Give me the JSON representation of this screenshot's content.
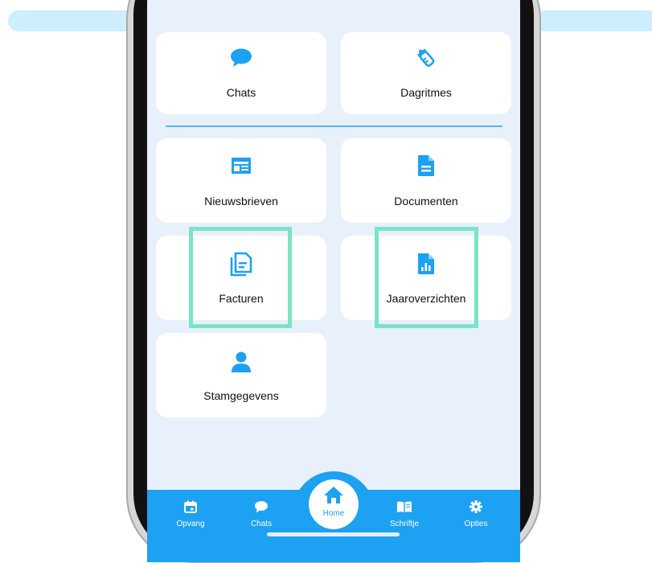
{
  "colors": {
    "accent": "#1da1f2",
    "highlight": "#7be4c6",
    "screen_bg": "#e8f1fb"
  },
  "grid": {
    "chats": {
      "label": "Chats",
      "icon": "chat-bubble-icon"
    },
    "dagritmes": {
      "label": "Dagritmes",
      "icon": "baby-bottle-icon"
    },
    "nieuwsbrieven": {
      "label": "Nieuwsbrieven",
      "icon": "newspaper-icon"
    },
    "documenten": {
      "label": "Documenten",
      "icon": "document-icon"
    },
    "facturen": {
      "label": "Facturen",
      "icon": "invoice-copy-icon"
    },
    "jaaroverzichten": {
      "label": "Jaaroverzichten",
      "icon": "report-chart-icon"
    },
    "stamgegevens": {
      "label": "Stamgegevens",
      "icon": "person-icon"
    }
  },
  "tabbar": {
    "opvang": "Opvang",
    "chats": "Chats",
    "home": "Home",
    "schriftje": "Schriftje",
    "opties": "Opties"
  }
}
